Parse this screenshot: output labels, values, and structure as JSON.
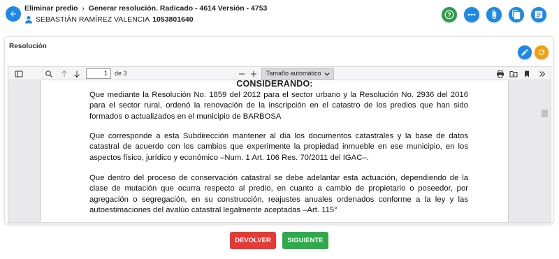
{
  "header": {
    "breadcrumb_1": "Eliminar predio",
    "breadcrumb_sep": "›",
    "breadcrumb_2": "Generar resolución. Radicado - 4614 Versión - 4753",
    "user_name": "SEBASTIÁN RAMÍREZ VALENCIA",
    "user_doc": "1053801640",
    "actions": [
      {
        "icon": "help-icon",
        "color": "#2e9d48"
      },
      {
        "icon": "more-horizontal-icon",
        "color": "#1e88e5"
      },
      {
        "icon": "attachment-icon",
        "color": "#1e88e5"
      },
      {
        "icon": "copy-icon",
        "color": "#1e88e5"
      },
      {
        "icon": "notes-icon",
        "color": "#1e88e5"
      }
    ]
  },
  "card": {
    "title": "Resolución",
    "actions": [
      {
        "icon": "edit-icon",
        "color": "#1e88e5"
      },
      {
        "icon": "refresh-icon",
        "color": "#f59e0b"
      }
    ]
  },
  "viewer": {
    "page_current": "1",
    "page_of": "de 3",
    "zoom": "Tamaño automático"
  },
  "document": {
    "heading": "CONSIDERANDO:",
    "paragraphs": [
      "Que mediante la Resolución No. 1859 del 2012 para el sector urbano y la Resolución No. 2936 del 2016 para el sector rural, ordenó la renovación de la inscripción en el catastro de los predios que han sido formados o actualizados en el municipio de BARBOSA",
      "Que corresponde a esta Subdirección mantener al día los documentos catastrales y la base de datos catastral de acuerdo con los cambios que experimente la propiedad inmueble en ese municipio, en los aspectos físico, jurídico y económico –Num. 1 Art. 106 Res. 70/2011 del IGAC–.",
      "Que dentro del proceso de conservación catastral se debe adelantar esta actuación, dependiendo de la clase de mutación que ocurra respecto al predio, en cuanto a cambio de propietario o poseedor, por agregación o segregación, en su construcción, reajustes anuales ordenados conforme a la ley y las autoestimaciones del avalúo catastral legalmente aceptadas –Art. 115°"
    ]
  },
  "footer": {
    "return_label": "DEVOLVER",
    "next_label": "SIGUIENTE"
  },
  "colors": {
    "primary": "#1e88e5",
    "danger": "#e53935",
    "success": "#2eaa4a",
    "warning": "#f59e0b"
  }
}
